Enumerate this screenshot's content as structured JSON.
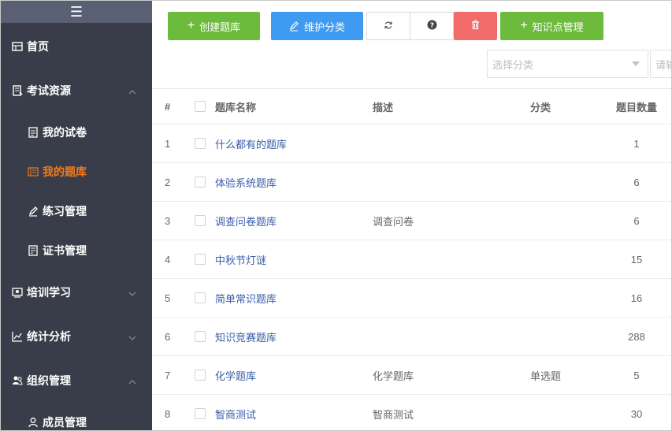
{
  "sidebar": {
    "toggle": "☰",
    "items": [
      {
        "label": "首页",
        "icon": "home-icon",
        "level": 1
      },
      {
        "label": "考试资源",
        "icon": "exam-resource-icon",
        "level": 1,
        "expanded": true
      },
      {
        "label": "我的试卷",
        "icon": "paper-icon",
        "level": 2
      },
      {
        "label": "我的题库",
        "icon": "question-bank-icon",
        "level": 2,
        "active": true
      },
      {
        "label": "练习管理",
        "icon": "pencil-icon",
        "level": 2
      },
      {
        "label": "证书管理",
        "icon": "certificate-icon",
        "level": 2
      },
      {
        "label": "培训学习",
        "icon": "training-icon",
        "level": 1,
        "expanded": false
      },
      {
        "label": "统计分析",
        "icon": "chart-icon",
        "level": 1,
        "expanded": false
      },
      {
        "label": "组织管理",
        "icon": "org-icon",
        "level": 1,
        "expanded": true
      },
      {
        "label": "成员管理",
        "icon": "user-icon",
        "level": 2
      }
    ]
  },
  "toolbar": {
    "create_label": "创建题库",
    "category_label": "维护分类",
    "knowledge_label": "知识点管理"
  },
  "filters": {
    "category_placeholder": "选择分类",
    "search_placeholder": "请输"
  },
  "table": {
    "headers": {
      "num": "#",
      "name": "题库名称",
      "desc": "描述",
      "category": "分类",
      "count": "题目数量"
    },
    "rows": [
      {
        "num": "1",
        "name": "什么都有的题库",
        "desc": "",
        "category": "",
        "count": "1"
      },
      {
        "num": "2",
        "name": "体验系统题库",
        "desc": "",
        "category": "",
        "count": "6"
      },
      {
        "num": "3",
        "name": "调查问卷题库",
        "desc": "调查问卷",
        "category": "",
        "count": "6"
      },
      {
        "num": "4",
        "name": "中秋节灯谜",
        "desc": "",
        "category": "",
        "count": "15"
      },
      {
        "num": "5",
        "name": "简单常识题库",
        "desc": "",
        "category": "",
        "count": "16"
      },
      {
        "num": "6",
        "name": "知识竞赛题库",
        "desc": "",
        "category": "",
        "count": "288"
      },
      {
        "num": "7",
        "name": "化学题库",
        "desc": "化学题库",
        "category": "单选题",
        "count": "5"
      },
      {
        "num": "8",
        "name": "智商测试",
        "desc": "智商测试",
        "category": "",
        "count": "30"
      }
    ]
  },
  "colors": {
    "sidebar_bg": "#393d49",
    "active_text": "#f37b1d",
    "green": "#6cbb3c",
    "blue": "#3f9bf2",
    "red": "#f26b6b",
    "link": "#3a5da8"
  }
}
